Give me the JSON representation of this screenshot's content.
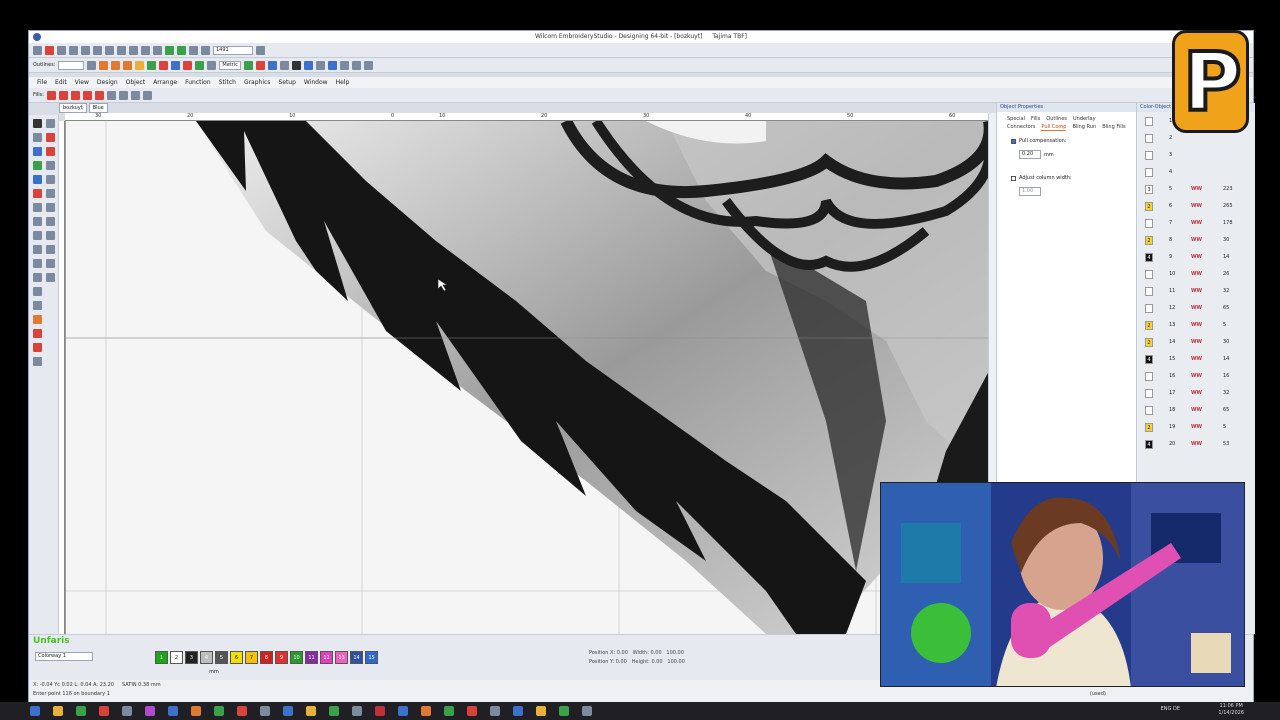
{
  "window": {
    "title": "Wilcom EmbroideryStudio - Designing 64-bit - [bozkuyt]",
    "machine": "Tajima TBF]"
  },
  "menu": [
    "File",
    "Edit",
    "View",
    "Design",
    "Object",
    "Arrange",
    "Function",
    "Stitch",
    "Graphics",
    "Setup",
    "Window",
    "Help"
  ],
  "toolbar": {
    "outlines_label": "Outlines:",
    "fills_label": "Fills:",
    "zoom_value": "1491",
    "units_value": "Metric"
  },
  "doc_tabs": [
    "bozkuyt",
    "Blue"
  ],
  "rulers": {
    "h": [
      "30",
      "20",
      "10",
      "0",
      "10",
      "20",
      "30",
      "40",
      "50",
      "60",
      "70",
      "80",
      "90"
    ]
  },
  "properties": {
    "title": "Object Properties",
    "tabs": [
      "Special",
      "Fills",
      "Outlines",
      "Underlay",
      "Connectors",
      "Pull Comp",
      "Bling Run",
      "Bling Fills"
    ],
    "active_tab": "Pull Comp",
    "pull_comp_label": "Pull compensation:",
    "pull_comp_value": "0.20",
    "pull_comp_unit": "mm",
    "adjust_width_label": "Adjust column width:",
    "adjust_width_value": "1.00"
  },
  "color_objects": {
    "title": "Color-Object List",
    "rows": [
      {
        "sw": "",
        "num": "1",
        "stitch": "",
        "cnt": ""
      },
      {
        "sw": "",
        "num": "2",
        "stitch": "",
        "cnt": ""
      },
      {
        "sw": "",
        "num": "3",
        "stitch": "",
        "cnt": ""
      },
      {
        "sw": "",
        "num": "4",
        "stitch": "",
        "cnt": ""
      },
      {
        "sw": "3",
        "num": "5",
        "stitch": "WW",
        "cnt": "223"
      },
      {
        "sw": "2",
        "num": "6",
        "stitch": "WW",
        "cnt": "265"
      },
      {
        "sw": "",
        "num": "7",
        "stitch": "WW",
        "cnt": "178"
      },
      {
        "sw": "2",
        "num": "8",
        "stitch": "WW",
        "cnt": "30"
      },
      {
        "sw": "4",
        "num": "9",
        "stitch": "WW",
        "cnt": "14"
      },
      {
        "sw": "",
        "num": "10",
        "stitch": "WW",
        "cnt": "26"
      },
      {
        "sw": "",
        "num": "11",
        "stitch": "WW",
        "cnt": "32"
      },
      {
        "sw": "",
        "num": "12",
        "stitch": "WW",
        "cnt": "65"
      },
      {
        "sw": "2",
        "num": "13",
        "stitch": "WW",
        "cnt": "5"
      },
      {
        "sw": "2",
        "num": "14",
        "stitch": "WW",
        "cnt": "30"
      },
      {
        "sw": "4",
        "num": "15",
        "stitch": "WW",
        "cnt": "14"
      },
      {
        "sw": "",
        "num": "16",
        "stitch": "WW",
        "cnt": "16"
      },
      {
        "sw": "",
        "num": "17",
        "stitch": "WW",
        "cnt": "32"
      },
      {
        "sw": "",
        "num": "18",
        "stitch": "WW",
        "cnt": "65"
      },
      {
        "sw": "2",
        "num": "19",
        "stitch": "WW",
        "cnt": "5"
      },
      {
        "sw": "4",
        "num": "20",
        "stitch": "WW",
        "cnt": "53"
      }
    ]
  },
  "bottom": {
    "brand": "Unfaris",
    "colorway": "Colorway 1",
    "palette": [
      {
        "label": "1",
        "color": "#1ea51e"
      },
      {
        "label": "2",
        "color": "#ffffff"
      },
      {
        "label": "3",
        "color": "#222222"
      },
      {
        "label": "4",
        "color": "#bdbdbd"
      },
      {
        "label": "5",
        "color": "#555555"
      },
      {
        "label": "6",
        "color": "#f0e000"
      },
      {
        "label": "7",
        "color": "#f5c200"
      },
      {
        "label": "8",
        "color": "#d02020"
      },
      {
        "label": "9",
        "color": "#e03030"
      },
      {
        "label": "10",
        "color": "#2a9a2a"
      },
      {
        "label": "11",
        "color": "#8a2aa0"
      },
      {
        "label": "12",
        "color": "#e040c0"
      },
      {
        "label": "13",
        "color": "#f060c0"
      },
      {
        "label": "14",
        "color": "#3050a0"
      },
      {
        "label": "15",
        "color": "#2a6ad0"
      }
    ],
    "position_x_label": "Position X:",
    "position_x": "0.00",
    "position_y_label": "Position Y:",
    "position_y": "0.00",
    "width_label": "Width:",
    "width": "0.00",
    "height_label": "Height:",
    "height": "0.00",
    "pct1": "100.00",
    "pct2": "100.00",
    "unit": "mm"
  },
  "status": {
    "coords": "X: -0.04 Yc  0.02 L: 0.04 A: 23.20",
    "stitch": "SATIN 0.38 mm",
    "hint": "Enter point 116 on boundary 1",
    "used": "(used)"
  },
  "taskbar": {
    "time": "11:06 PM",
    "date": "1/14/2026",
    "lang": "ENG DE",
    "icon_colors": [
      "#3b71c8",
      "#e8b23a",
      "#3aa14a",
      "#d8433b",
      "#7c8aa0",
      "#b04ad0",
      "#3b71c8",
      "#e07a2e",
      "#3aa14a",
      "#d8433b",
      "#7c8aa0",
      "#3b71c8",
      "#e8b23a",
      "#3aa14a",
      "#7c8aa0",
      "#c0303a",
      "#3b71c8",
      "#e07a2e",
      "#3aa14a",
      "#d8433b",
      "#7c8aa0",
      "#3b71c8",
      "#e8b23a",
      "#3aa14a",
      "#7c8aa0"
    ]
  }
}
